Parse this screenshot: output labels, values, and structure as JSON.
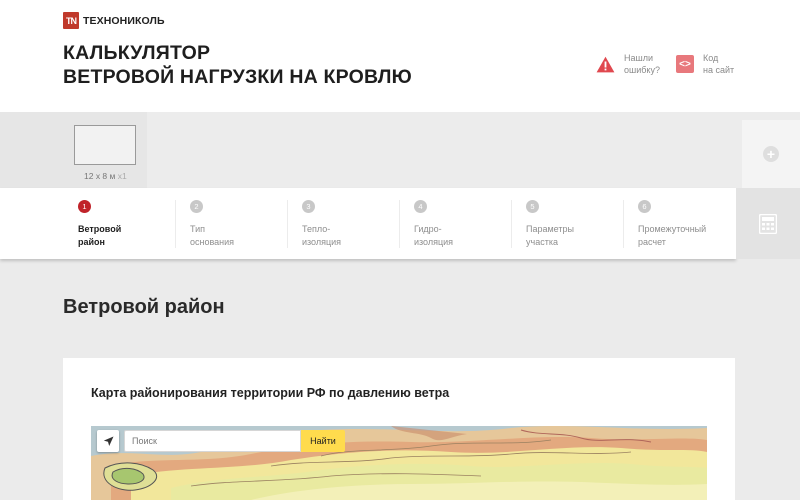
{
  "brand": {
    "logo_mark": "TN",
    "name": "ТЕХНОНИКОЛЬ"
  },
  "page_title": {
    "line1": "КАЛЬКУЛЯТОР",
    "line2": "ВЕТРОВОЙ НАГРУЗКИ НА КРОВЛЮ"
  },
  "header_actions": {
    "report_error": {
      "line1": "Нашли",
      "line2": "ошибку?"
    },
    "embed_code": {
      "line1": "Код",
      "line2": "на сайт",
      "icon_glyph": "<>"
    }
  },
  "roofs": {
    "dimensions": "12 х 8 м",
    "count": "x1",
    "add_icon_glyph": "+"
  },
  "steps": [
    {
      "num": "1",
      "line1": "Ветровой",
      "line2": "район",
      "active": true
    },
    {
      "num": "2",
      "line1": "Тип",
      "line2": "основания",
      "active": false
    },
    {
      "num": "3",
      "line1": "Тепло-",
      "line2": "изоляция",
      "active": false
    },
    {
      "num": "4",
      "line1": "Гидро-",
      "line2": "изоляция",
      "active": false
    },
    {
      "num": "5",
      "line1": "Параметры",
      "line2": "участка",
      "active": false
    },
    {
      "num": "6",
      "line1": "Промежуточный",
      "line2": "расчет",
      "active": false
    }
  ],
  "section_title": "Ветровой район",
  "map_card": {
    "title": "Карта районирования территории РФ по давлению ветра",
    "search_placeholder": "Поиск",
    "search_button": "Найти"
  },
  "colors": {
    "accent": "#c0232a",
    "yellow_button": "#ffdb4d",
    "icon_pink": "#e8787c"
  },
  "icons": [
    "warning-icon",
    "code-icon",
    "plus-icon",
    "calculator-icon",
    "locate-icon"
  ]
}
